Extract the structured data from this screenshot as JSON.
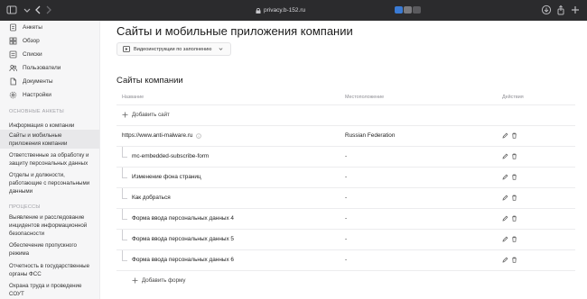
{
  "browser": {
    "url": "privacy.b-152.ru",
    "colors": {
      "toolbar_bg": "#2b2b2d"
    }
  },
  "sidebar": {
    "main_items": [
      {
        "label": "Анкеты",
        "icon": "forms-icon"
      },
      {
        "label": "Обзор",
        "icon": "grid-icon"
      },
      {
        "label": "Списки",
        "icon": "list-icon"
      },
      {
        "label": "Пользователи",
        "icon": "users-icon"
      },
      {
        "label": "Документы",
        "icon": "document-icon"
      },
      {
        "label": "Настройки",
        "icon": "gear-icon"
      }
    ],
    "section_main_forms": "ОСНОВНЫЕ АНКЕТЫ",
    "forms": [
      "Информация о компании",
      "Сайты и мобильные приложения компании",
      "Ответственные за обработку и защиту персональных данных",
      "Отделы и должности, работающие с персональными данными"
    ],
    "section_processes": "ПРОЦЕССЫ",
    "processes": [
      "Выявление и расследование инцидентов информационной безопасности",
      "Обеспечение пропускного режима",
      "Отчетность в государственные органы ФСС",
      "Охрана труда и проведение СОУТ"
    ]
  },
  "main": {
    "title": "Сайты и мобильные приложения компании",
    "video_button_label": "Видеоинструкции по заполнению",
    "section_title": "Сайты компании",
    "table": {
      "col_name": "Название",
      "col_location": "Местоположение",
      "col_actions": "Действия",
      "add_site_label": "Добавить сайт",
      "site": {
        "name": "https://www.anti-malware.ru",
        "location": "Russian Federation"
      },
      "forms": [
        {
          "name": "mc-embedded-subscribe-form",
          "location": "-"
        },
        {
          "name": "Изменение фона страниц",
          "location": "-"
        },
        {
          "name": "Как добраться",
          "location": "-"
        },
        {
          "name": "Форма ввода персональных данных 4",
          "location": "-"
        },
        {
          "name": "Форма ввода персональных данных 5",
          "location": "-"
        },
        {
          "name": "Форма ввода персональных данных 6",
          "location": "-"
        }
      ],
      "add_form_label": "Добавить форму"
    }
  }
}
